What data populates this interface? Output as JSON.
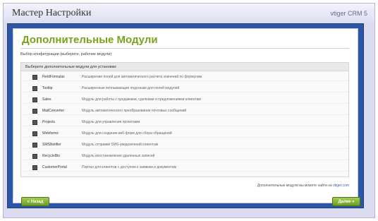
{
  "window": {
    "title": "Мастер Настройки",
    "version": "vtiger CRM 5"
  },
  "page": {
    "title": "Дополнительные Модули",
    "subtitle": "Выбор конфигурации (выберите, рабочие модули)"
  },
  "modules": {
    "header": "Выберите дополнительные модули для установки:",
    "items": [
      {
        "name": "FieldFormulas",
        "desc": "Расширение полей для автоматического расчета значений по формулам"
      },
      {
        "name": "Tooltip",
        "desc": "Расширенные всплывающие подсказки для полей модулей"
      },
      {
        "name": "Sales",
        "desc": "Модуль для работы с продажами, сделками и предложениями клиентам"
      },
      {
        "name": "MailConverter",
        "desc": "Модуль автоматического преобразования почтовых сообщений"
      },
      {
        "name": "Projects",
        "desc": "Модуль для управления проектами"
      },
      {
        "name": "Webforms",
        "desc": "Модуль для создания веб-форм для сбора обращений"
      },
      {
        "name": "SMSNotifier",
        "desc": "Модуль отправки SMS-уведомлений клиентам"
      },
      {
        "name": "RecycleBin",
        "desc": "Модуль восстановления удаленных записей"
      },
      {
        "name": "CustomerPortal",
        "desc": "Портал для клиентов с доступом к заявкам и документам"
      }
    ]
  },
  "footer": {
    "note_prefix": "Дополнительные модули вы можете найти на",
    "note_link": "vtiger.com"
  },
  "buttons": {
    "back": "« Назад",
    "next": "Далее »"
  }
}
